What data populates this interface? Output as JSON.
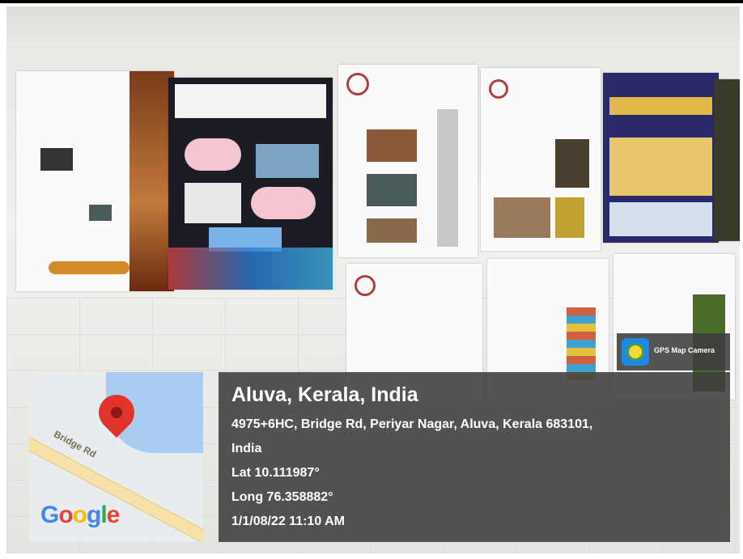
{
  "watermark": {
    "app_name": "GPS Map Camera",
    "app_icon": "gps-map-camera-icon"
  },
  "map": {
    "road_label": "Bridge Rd",
    "brand": "Google",
    "pin_icon": "map-pin-icon",
    "colors": {
      "water": "#a9cdf2",
      "road": "#f6e2a8",
      "pin": "#e0342b"
    }
  },
  "location": {
    "title": "Aluva, Kerala, India",
    "address_line1": "4975+6HC, Bridge Rd, Periyar Nagar, Aluva, Kerala 683101,",
    "address_line2": "India",
    "lat": "Lat 10.111987°",
    "long": "Long 76.358882°",
    "datetime": "1/1/08/22 11:10 AM"
  }
}
